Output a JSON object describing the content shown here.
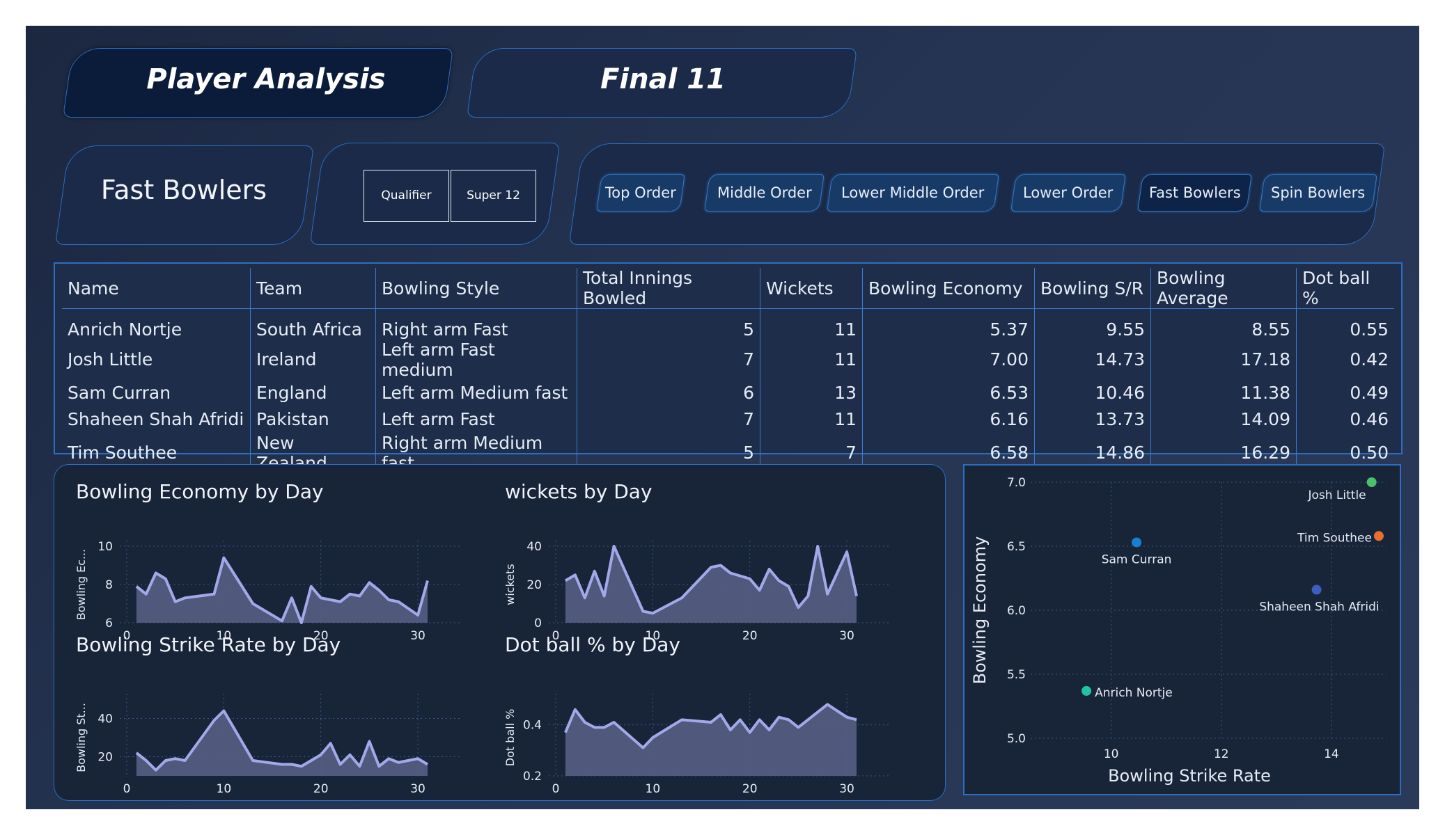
{
  "header": {
    "player_analysis": "Player Analysis",
    "final_11": "Final 11"
  },
  "category": {
    "title": "Fast Bowlers",
    "stage_buttons": [
      "Qualifier",
      "Super 12"
    ]
  },
  "nav": {
    "items": [
      "Top Order",
      "Middle Order",
      "Lower Middle Order",
      "Lower Order",
      "Fast Bowlers",
      "Spin Bowlers"
    ],
    "active": "Fast Bowlers"
  },
  "table": {
    "columns": [
      "Name",
      "Team",
      "Bowling Style",
      "Total Innings Bowled",
      "Wickets",
      "Bowling Economy",
      "Bowling S/R",
      "Bowling Average",
      "Dot ball %"
    ],
    "rows": [
      [
        "Anrich Nortje",
        "South Africa",
        "Right arm Fast",
        "5",
        "11",
        "5.37",
        "9.55",
        "8.55",
        "0.55"
      ],
      [
        "Josh Little",
        "Ireland",
        "Left arm Fast medium",
        "7",
        "11",
        "7.00",
        "14.73",
        "17.18",
        "0.42"
      ],
      [
        "Sam Curran",
        "England",
        "Left arm Medium fast",
        "6",
        "13",
        "6.53",
        "10.46",
        "11.38",
        "0.49"
      ],
      [
        "Shaheen Shah Afridi",
        "Pakistan",
        "Left arm Fast",
        "7",
        "11",
        "6.16",
        "13.73",
        "14.09",
        "0.46"
      ],
      [
        "Tim Southee",
        "New Zealand",
        "Right arm Medium fast",
        "5",
        "7",
        "6.58",
        "14.86",
        "16.29",
        "0.50"
      ]
    ]
  },
  "colors": {
    "accent_blue": "#2c6fc0",
    "area_fill": "#5a6188",
    "area_line": "#a3a8e8"
  },
  "chart_data": [
    {
      "type": "area",
      "title": "Bowling Economy by Day",
      "ylabel": "Bowling Ec...",
      "xlabel": "",
      "x_ticks": [
        0,
        10,
        20,
        30
      ],
      "y_ticks": [
        6,
        8,
        10
      ],
      "xlim": [
        0,
        31
      ],
      "ylim": [
        6,
        10
      ],
      "x": [
        1,
        2,
        3,
        4,
        5,
        6,
        9,
        10,
        13,
        16,
        17,
        18,
        19,
        20,
        22,
        23,
        24,
        25,
        26,
        27,
        28,
        30,
        31
      ],
      "values": [
        7.9,
        7.5,
        8.6,
        8.3,
        7.1,
        7.3,
        7.5,
        9.4,
        7.0,
        6.1,
        7.3,
        6.0,
        7.9,
        7.3,
        7.1,
        7.5,
        7.4,
        8.1,
        7.7,
        7.2,
        7.1,
        6.4,
        8.2
      ]
    },
    {
      "type": "area",
      "title": "wickets by Day",
      "ylabel": "wickets",
      "xlabel": "",
      "x_ticks": [
        0,
        10,
        20,
        30
      ],
      "y_ticks": [
        0,
        20,
        40
      ],
      "xlim": [
        0,
        31
      ],
      "ylim": [
        0,
        40
      ],
      "x": [
        1,
        2,
        3,
        4,
        5,
        6,
        9,
        10,
        13,
        16,
        17,
        18,
        20,
        21,
        22,
        23,
        24,
        25,
        26,
        27,
        28,
        30,
        31
      ],
      "values": [
        22,
        25,
        13,
        27,
        14,
        40,
        6,
        5,
        13,
        29,
        30,
        26,
        23,
        17,
        28,
        22,
        19,
        8,
        14,
        40,
        15,
        37,
        14
      ]
    },
    {
      "type": "area",
      "title": "Bowling Strike Rate by Day",
      "ylabel": "Bowling St...",
      "xlabel": "",
      "x_ticks": [
        0,
        10,
        20,
        30
      ],
      "y_ticks": [
        20,
        40
      ],
      "xlim": [
        0,
        31
      ],
      "ylim": [
        10,
        50
      ],
      "x": [
        1,
        2,
        3,
        4,
        5,
        6,
        9,
        10,
        13,
        16,
        17,
        18,
        20,
        21,
        22,
        23,
        24,
        25,
        26,
        27,
        28,
        30,
        31
      ],
      "values": [
        22,
        18,
        13,
        18,
        19,
        18,
        39,
        44,
        18,
        16,
        16,
        15,
        21,
        27,
        16,
        21,
        15,
        28,
        15,
        19,
        17,
        19,
        16
      ]
    },
    {
      "type": "area",
      "title": "Dot ball % by Day",
      "ylabel": "Dot ball %",
      "xlabel": "",
      "x_ticks": [
        0,
        10,
        20,
        30
      ],
      "y_ticks": [
        0.2,
        0.4
      ],
      "xlim": [
        0,
        31
      ],
      "ylim": [
        0.2,
        0.5
      ],
      "x": [
        1,
        2,
        3,
        4,
        5,
        6,
        9,
        10,
        13,
        16,
        17,
        18,
        19,
        20,
        21,
        22,
        23,
        24,
        25,
        26,
        27,
        28,
        30,
        31
      ],
      "values": [
        0.37,
        0.46,
        0.41,
        0.39,
        0.39,
        0.41,
        0.31,
        0.35,
        0.42,
        0.41,
        0.44,
        0.38,
        0.42,
        0.37,
        0.42,
        0.38,
        0.43,
        0.42,
        0.39,
        0.42,
        0.45,
        0.48,
        0.43,
        0.42
      ]
    },
    {
      "type": "scatter",
      "title": "",
      "xlabel": "Bowling Strike Rate",
      "ylabel": "Bowling Economy",
      "x_ticks": [
        10,
        12,
        14
      ],
      "y_ticks": [
        5.0,
        5.5,
        6.0,
        6.5,
        7.0
      ],
      "xlim": [
        8.6,
        15.0
      ],
      "ylim": [
        5.0,
        7.0
      ],
      "points": [
        {
          "label": "Anrich Nortje",
          "x": 9.55,
          "y": 5.37,
          "color": "#1fc4a6"
        },
        {
          "label": "Josh Little",
          "x": 14.73,
          "y": 7.0,
          "color": "#49c26a"
        },
        {
          "label": "Sam Curran",
          "x": 10.46,
          "y": 6.53,
          "color": "#1a7fd0"
        },
        {
          "label": "Shaheen Shah Afridi",
          "x": 13.73,
          "y": 6.16,
          "color": "#3f5cc0"
        },
        {
          "label": "Tim Southee",
          "x": 14.86,
          "y": 6.58,
          "color": "#e8702a"
        }
      ]
    }
  ]
}
